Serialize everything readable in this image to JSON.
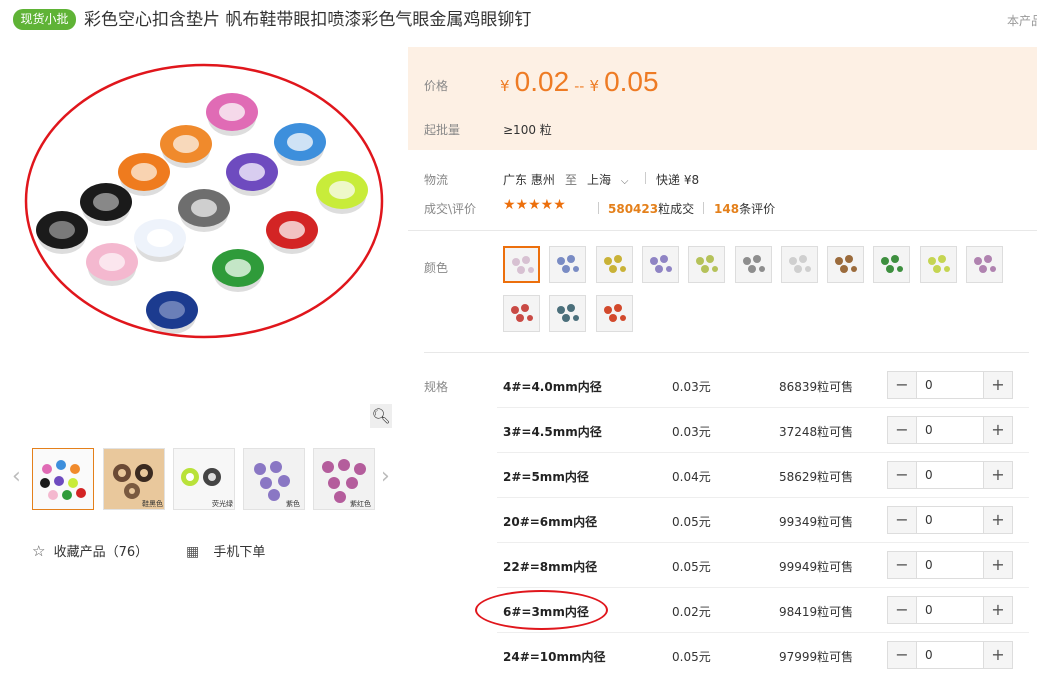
{
  "header": {
    "badge": "现货小批",
    "title": "彩色空心扣含垫片 帆布鞋带眼扣喷漆彩色气眼金属鸡眼铆钉",
    "corner": "本产品"
  },
  "gallery": {
    "zoom_icon": "search-icon",
    "prev_icon": "chevron-left-icon",
    "next_icon": "chevron-right-icon",
    "thumbs": [
      {
        "label": "",
        "color": "#e0e0e0"
      },
      {
        "label": "鞋黑色",
        "color": "#6b4a35"
      },
      {
        "label": "荧光绿",
        "color": "#b9e23a"
      },
      {
        "label": "紫色",
        "color": "#8a77c4"
      },
      {
        "label": "紫红色",
        "color": "#b45d9c"
      }
    ],
    "favorite_label": "收藏产品（76）",
    "mobile_label": "手机下单"
  },
  "price": {
    "label": "价格",
    "low": "0.02",
    "sep": "--",
    "high": "0.05",
    "yen": "¥",
    "moq_label": "起批量",
    "moq_value": "≥100 粒"
  },
  "logistics": {
    "label": "物流",
    "from": "广东 惠州",
    "to_word": "至",
    "to": "上海",
    "express": "快递 ¥8"
  },
  "deals": {
    "label": "成交\\评价",
    "stars": "★★★★★",
    "sold_num": "580423",
    "sold_suffix": "粒成交",
    "review_num": "148",
    "review_suffix": "条评价"
  },
  "colors": {
    "label": "颜色",
    "swatches": [
      "#d7c1d2",
      "#7a8cc4",
      "#c9b237",
      "#8f84c4",
      "#b5c25a",
      "#8e8e8e",
      "#cfcfcf",
      "#9b6b3c",
      "#3e8f3f",
      "#c5d552",
      "#b083b0",
      "#c94a45",
      "#4b6f7b",
      "#d2492c"
    ]
  },
  "specs": {
    "label": "规格",
    "rows": [
      {
        "name": "4#=4.0mm内径",
        "price": "0.03元",
        "stock": "86839粒可售",
        "qty": "0"
      },
      {
        "name": "3#=4.5mm内径",
        "price": "0.03元",
        "stock": "37248粒可售",
        "qty": "0"
      },
      {
        "name": "2#=5mm内径",
        "price": "0.04元",
        "stock": "58629粒可售",
        "qty": "0"
      },
      {
        "name": "20#=6mm内径",
        "price": "0.05元",
        "stock": "99349粒可售",
        "qty": "0"
      },
      {
        "name": "22#=8mm内径",
        "price": "0.05元",
        "stock": "99949粒可售",
        "qty": "0"
      },
      {
        "name": "6#=3mm内径",
        "price": "0.02元",
        "stock": "98419粒可售",
        "qty": "0"
      },
      {
        "name": "24#=10mm内径",
        "price": "0.05元",
        "stock": "97999粒可售",
        "qty": "0"
      }
    ],
    "minus": "−",
    "plus": "+"
  },
  "theme": {
    "accent": "#ee7b24",
    "badge": "#5fb336",
    "annotation": "#e0161c"
  }
}
